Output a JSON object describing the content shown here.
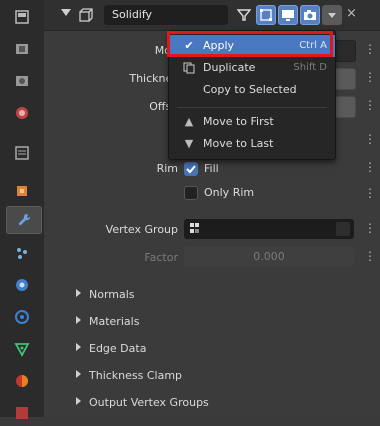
{
  "header": {
    "modifier_name": "Solidify",
    "close_label": "×",
    "icons": [
      "wrench-icon",
      "funnel-icon",
      "edit-mode-icon",
      "viewport-icon",
      "render-icon",
      "dropdown-icon"
    ]
  },
  "properties": {
    "mode_label": "Mod",
    "thickness_label": "Thicknes",
    "offset_label": "Offse",
    "rim_label": "Rim",
    "fill_label": "Fill",
    "only_rim_label": "Only Rim",
    "vertex_group_label": "Vertex Group",
    "factor_label": "Factor",
    "factor_value": "0.000"
  },
  "menu": {
    "apply": {
      "label": "Apply",
      "shortcut": "Ctrl A"
    },
    "duplicate": {
      "label": "Duplicate",
      "shortcut": "Shift D"
    },
    "copy_to_selected": {
      "label": "Copy to Selected"
    },
    "move_first": {
      "label": "Move to First"
    },
    "move_last": {
      "label": "Move to Last"
    }
  },
  "sections": [
    "Normals",
    "Materials",
    "Edge Data",
    "Thickness Clamp",
    "Output Vertex Groups"
  ],
  "colors": {
    "highlight": "#4a78c0",
    "annotation_box": "#e01818",
    "checkbox_on": "#4772b3"
  }
}
